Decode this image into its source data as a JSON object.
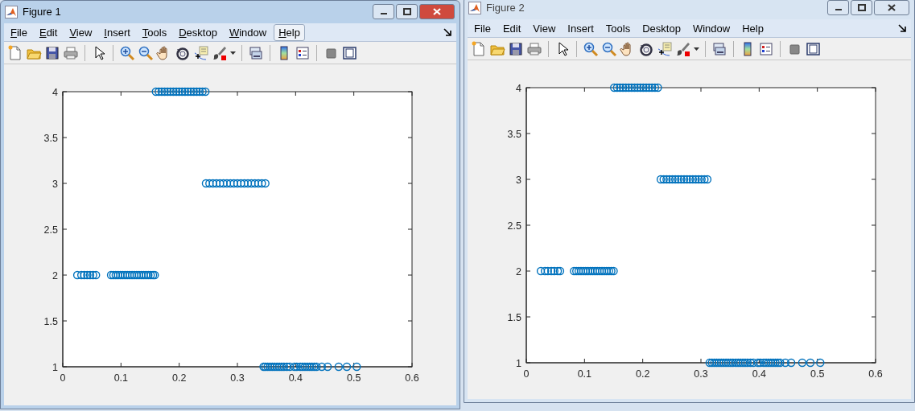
{
  "windows": [
    {
      "title": "Figure 1",
      "active": true,
      "show_mnemonics": true,
      "menu": [
        {
          "label": "File",
          "highlighted": false
        },
        {
          "label": "Edit",
          "highlighted": false
        },
        {
          "label": "View",
          "highlighted": false
        },
        {
          "label": "Insert",
          "highlighted": false
        },
        {
          "label": "Tools",
          "highlighted": false
        },
        {
          "label": "Desktop",
          "highlighted": false
        },
        {
          "label": "Window",
          "highlighted": false
        },
        {
          "label": "Help",
          "highlighted": true
        }
      ],
      "chart_data": {
        "type": "scatter",
        "xlim": [
          0,
          0.6
        ],
        "ylim": [
          1,
          4
        ],
        "xticks": [
          0,
          0.1,
          0.2,
          0.3,
          0.4,
          0.5,
          0.6
        ],
        "yticks": [
          1,
          1.5,
          2,
          2.5,
          3,
          3.5,
          4
        ],
        "x": [
          0.025,
          0.032,
          0.037,
          0.042,
          0.047,
          0.052,
          0.057,
          0.083,
          0.087,
          0.091,
          0.095,
          0.099,
          0.103,
          0.107,
          0.111,
          0.115,
          0.119,
          0.123,
          0.127,
          0.131,
          0.135,
          0.139,
          0.143,
          0.147,
          0.151,
          0.155,
          0.158,
          0.16,
          0.165,
          0.17,
          0.175,
          0.18,
          0.185,
          0.19,
          0.195,
          0.2,
          0.205,
          0.21,
          0.215,
          0.22,
          0.225,
          0.23,
          0.235,
          0.24,
          0.245,
          0.246,
          0.252,
          0.258,
          0.264,
          0.27,
          0.276,
          0.282,
          0.288,
          0.294,
          0.3,
          0.306,
          0.312,
          0.318,
          0.324,
          0.33,
          0.336,
          0.342,
          0.348,
          0.345,
          0.348,
          0.352,
          0.356,
          0.36,
          0.364,
          0.368,
          0.372,
          0.376,
          0.38,
          0.385,
          0.39,
          0.398,
          0.402,
          0.408,
          0.412,
          0.416,
          0.42,
          0.424,
          0.428,
          0.432,
          0.436,
          0.445,
          0.455,
          0.474,
          0.488,
          0.505
        ],
        "series": [
          {
            "color": "#0072bd",
            "values": [
              2,
              2,
              2,
              2,
              2,
              2,
              2,
              2,
              2,
              2,
              2,
              2,
              2,
              2,
              2,
              2,
              2,
              2,
              2,
              2,
              2,
              2,
              2,
              2,
              2,
              2,
              2,
              4,
              4,
              4,
              4,
              4,
              4,
              4,
              4,
              4,
              4,
              4,
              4,
              4,
              4,
              4,
              4,
              4,
              4,
              3,
              3,
              3,
              3,
              3,
              3,
              3,
              3,
              3,
              3,
              3,
              3,
              3,
              3,
              3,
              3,
              3,
              3,
              1,
              1,
              1,
              1,
              1,
              1,
              1,
              1,
              1,
              1,
              1,
              1,
              1,
              1,
              1,
              1,
              1,
              1,
              1,
              1,
              1,
              1,
              1,
              1,
              1,
              1,
              1
            ]
          }
        ]
      }
    },
    {
      "title": "Figure 2",
      "active": false,
      "show_mnemonics": false,
      "menu": [
        {
          "label": "File",
          "highlighted": false
        },
        {
          "label": "Edit",
          "highlighted": false
        },
        {
          "label": "View",
          "highlighted": false
        },
        {
          "label": "Insert",
          "highlighted": false
        },
        {
          "label": "Tools",
          "highlighted": false
        },
        {
          "label": "Desktop",
          "highlighted": false
        },
        {
          "label": "Window",
          "highlighted": false
        },
        {
          "label": "Help",
          "highlighted": false
        }
      ],
      "chart_data": {
        "type": "scatter",
        "xlim": [
          0,
          0.6
        ],
        "ylim": [
          1,
          4
        ],
        "xticks": [
          0,
          0.1,
          0.2,
          0.3,
          0.4,
          0.5,
          0.6
        ],
        "yticks": [
          1,
          1.5,
          2,
          2.5,
          3,
          3.5,
          4
        ],
        "x": [
          0.025,
          0.032,
          0.037,
          0.043,
          0.048,
          0.054,
          0.058,
          0.082,
          0.086,
          0.09,
          0.094,
          0.098,
          0.102,
          0.106,
          0.11,
          0.114,
          0.118,
          0.122,
          0.126,
          0.13,
          0.134,
          0.138,
          0.142,
          0.146,
          0.15,
          0.151,
          0.156,
          0.161,
          0.166,
          0.171,
          0.176,
          0.181,
          0.186,
          0.191,
          0.196,
          0.201,
          0.206,
          0.211,
          0.216,
          0.221,
          0.226,
          0.231,
          0.236,
          0.241,
          0.246,
          0.251,
          0.256,
          0.261,
          0.266,
          0.271,
          0.276,
          0.281,
          0.286,
          0.291,
          0.296,
          0.301,
          0.306,
          0.311,
          0.315,
          0.319,
          0.323,
          0.327,
          0.331,
          0.335,
          0.339,
          0.343,
          0.347,
          0.351,
          0.355,
          0.36,
          0.364,
          0.368,
          0.372,
          0.376,
          0.38,
          0.385,
          0.39,
          0.398,
          0.402,
          0.408,
          0.412,
          0.416,
          0.42,
          0.424,
          0.428,
          0.432,
          0.436,
          0.445,
          0.455,
          0.474,
          0.488,
          0.505
        ],
        "series": [
          {
            "color": "#0072bd",
            "values": [
              2,
              2,
              2,
              2,
              2,
              2,
              2,
              2,
              2,
              2,
              2,
              2,
              2,
              2,
              2,
              2,
              2,
              2,
              2,
              2,
              2,
              2,
              2,
              2,
              2,
              4,
              4,
              4,
              4,
              4,
              4,
              4,
              4,
              4,
              4,
              4,
              4,
              4,
              4,
              4,
              4,
              3,
              3,
              3,
              3,
              3,
              3,
              3,
              3,
              3,
              3,
              3,
              3,
              3,
              3,
              3,
              3,
              3,
              1,
              1,
              1,
              1,
              1,
              1,
              1,
              1,
              1,
              1,
              1,
              1,
              1,
              1,
              1,
              1,
              1,
              1,
              1,
              1,
              1,
              1,
              1,
              1,
              1,
              1,
              1,
              1,
              1,
              1,
              1,
              1,
              1,
              1
            ]
          }
        ]
      }
    }
  ]
}
